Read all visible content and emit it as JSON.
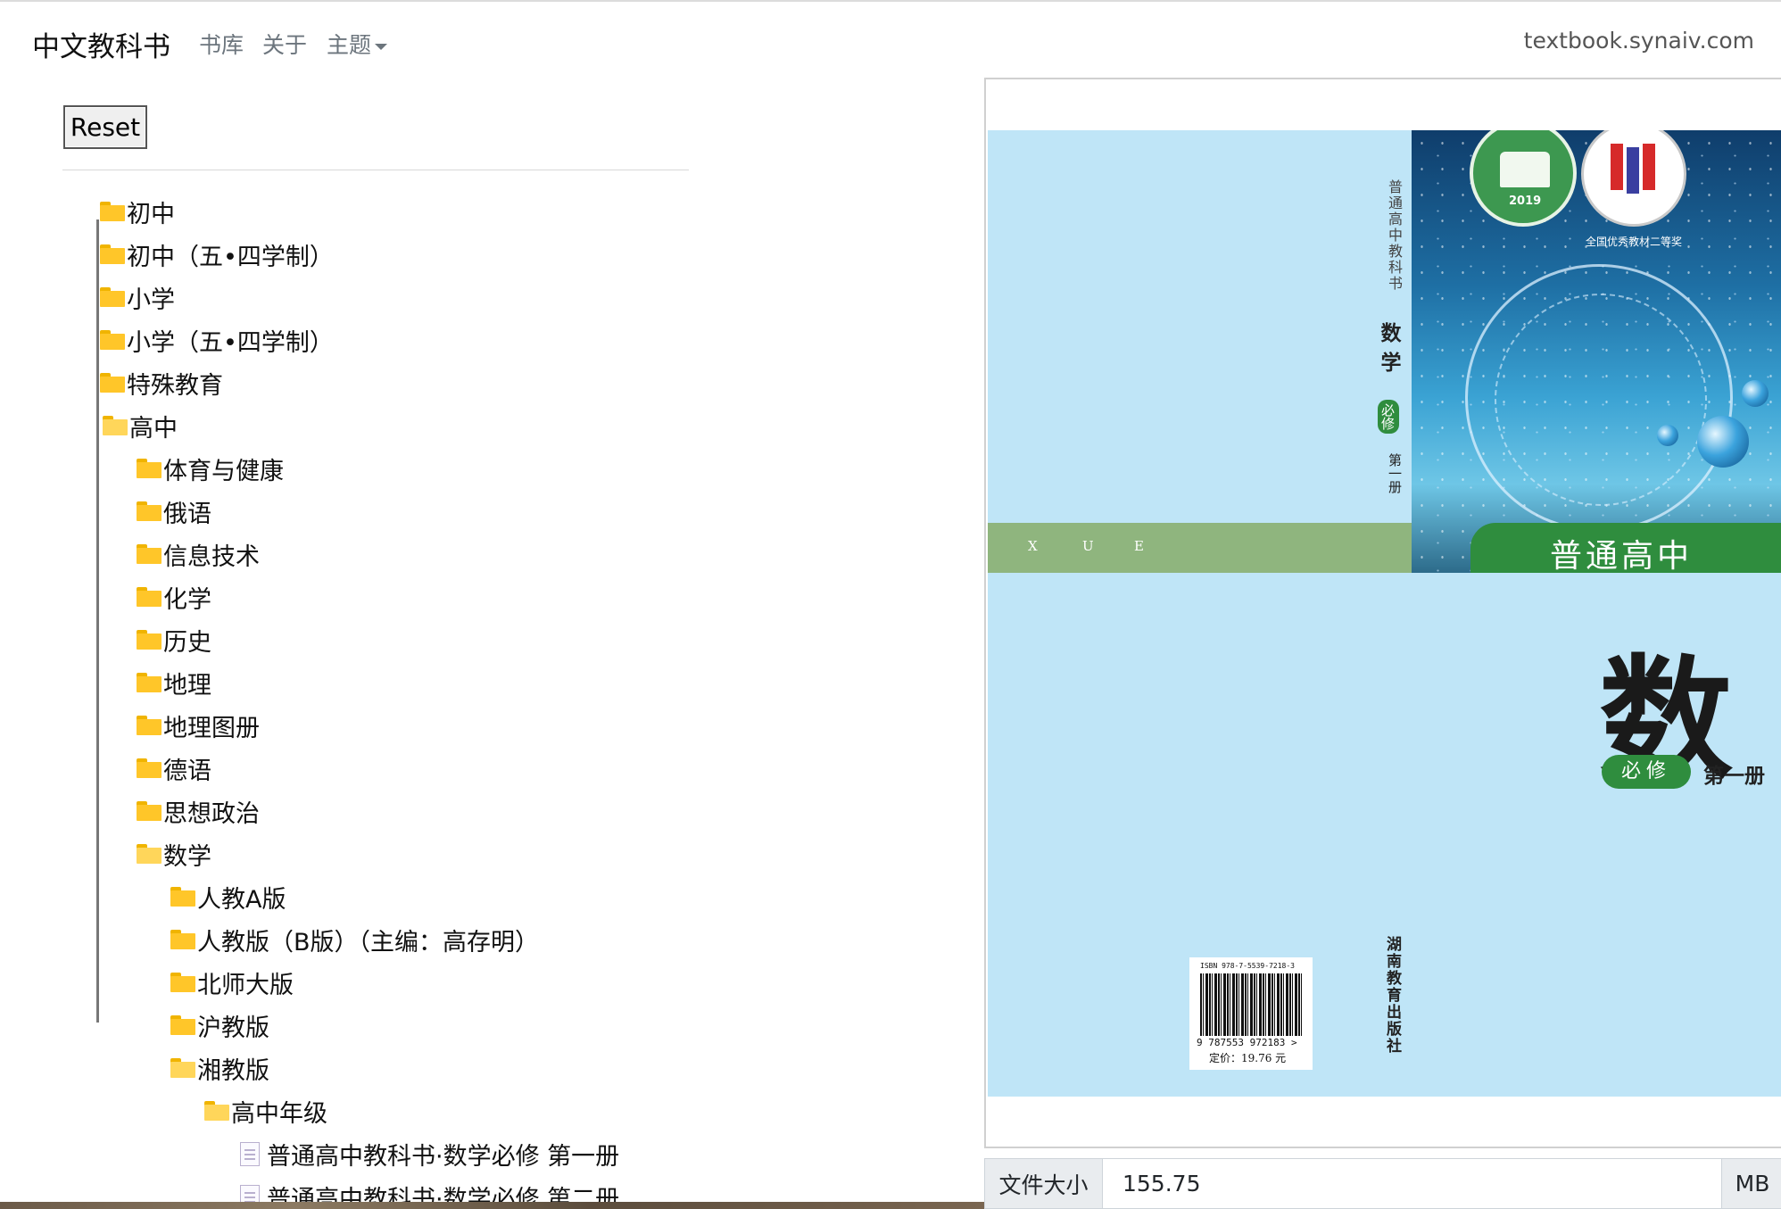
{
  "navbar": {
    "brand": "中文教科书",
    "links": [
      "书库",
      "关于"
    ],
    "theme_label": "主题",
    "site_url": "textbook.synaiv.com"
  },
  "sidebar": {
    "reset_label": "Reset",
    "tree": {
      "top_folders": [
        "初中",
        "初中（五•四学制）",
        "小学",
        "小学（五•四学制）",
        "特殊教育"
      ],
      "open_folder": "高中",
      "subjects": [
        "体育与健康",
        "俄语",
        "信息技术",
        "化学",
        "历史",
        "地理",
        "地理图册",
        "德语",
        "思想政治"
      ],
      "open_subject": "数学",
      "editions": [
        "人教A版",
        "人教版（B版）（主编：高存明）",
        "北师大版",
        "沪教版"
      ],
      "open_edition": "湘教版",
      "open_grade": "高中年级",
      "files": [
        "普通高中教科书·数学必修 第一册",
        "普通高中教科书·数学必修 第二册"
      ]
    }
  },
  "viewer": {
    "cover": {
      "spine_series": "普通高中教科书",
      "spine_subject": "数学",
      "spine_badge": "必修",
      "spine_volume": "第一册",
      "spine_publisher": "湖南教育出版社",
      "band_letters": [
        "X",
        "U",
        "E"
      ],
      "award_text": "全国优秀教材二等奖",
      "seal_year": "2019",
      "series_banner": "普通高中",
      "main_title": "数",
      "required_badge": "必修",
      "volume_title": "第一册",
      "isbn_small": "ISBN 978-7-5539-7218-3",
      "isbn_digits": "9 787553 972183 >",
      "price": "定价：19.76 元"
    }
  },
  "file_size": {
    "label": "文件大小",
    "value": "155.75",
    "unit": "MB"
  }
}
